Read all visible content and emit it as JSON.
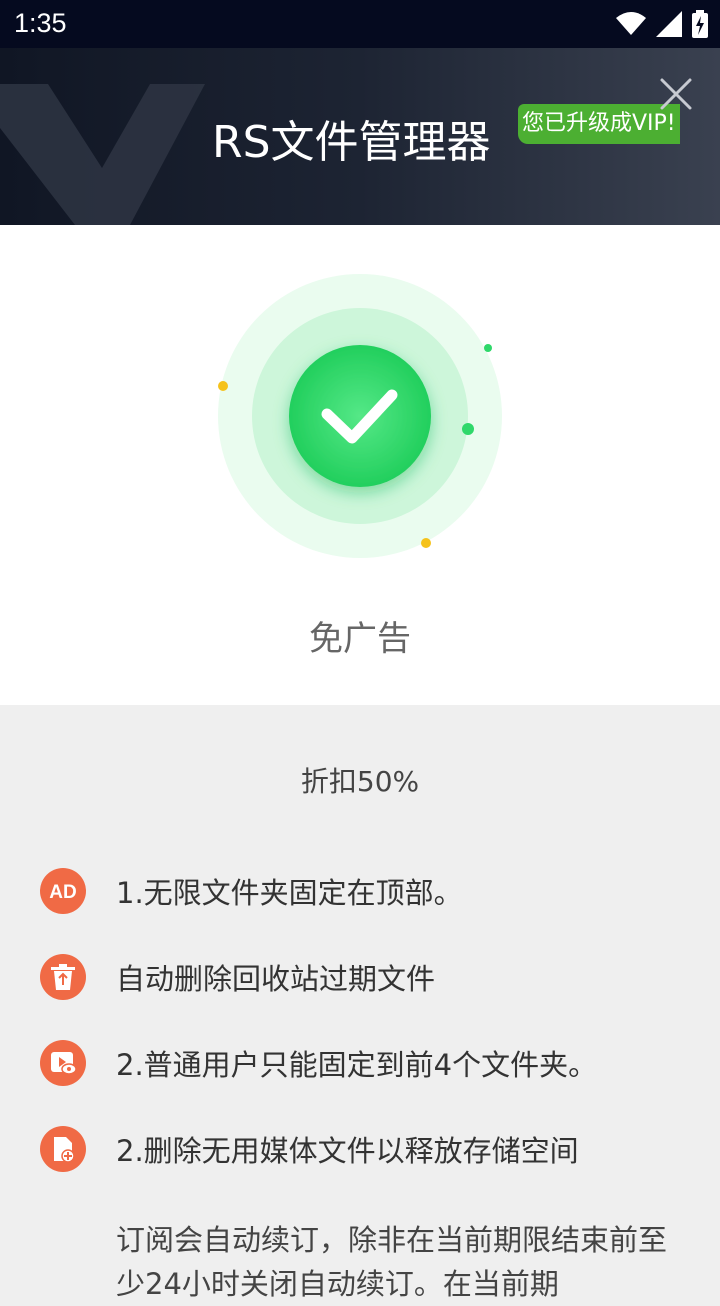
{
  "status_bar": {
    "time": "1:35",
    "icons": [
      "wifi-icon",
      "signal-icon",
      "battery-charging-icon"
    ]
  },
  "header": {
    "title": "RS文件管理器",
    "vip_badge": "您已升级成VIP!",
    "close_icon": "close-icon"
  },
  "hero": {
    "check_icon": "checkmark-icon",
    "caption": "免广告",
    "colors": {
      "check_green": "#2fd86a",
      "dot_yellow": "#f5c21b"
    }
  },
  "discount": "折扣50%",
  "features": [
    {
      "icon": "ad-icon",
      "label": "1.无限文件夹固定在顶部。"
    },
    {
      "icon": "recycle-bin-icon",
      "label": "自动删除回收站过期文件"
    },
    {
      "icon": "media-view-icon",
      "label": "2.普通用户只能固定到前4个文件夹。"
    },
    {
      "icon": "file-add-icon",
      "label": "2.删除无用媒体文件以释放存储空间"
    }
  ],
  "subscription_note": "订阅会自动续订，除非在当前期限结束前至少24小时关闭自动续订。在当前期",
  "accent_color": "#f06a45"
}
